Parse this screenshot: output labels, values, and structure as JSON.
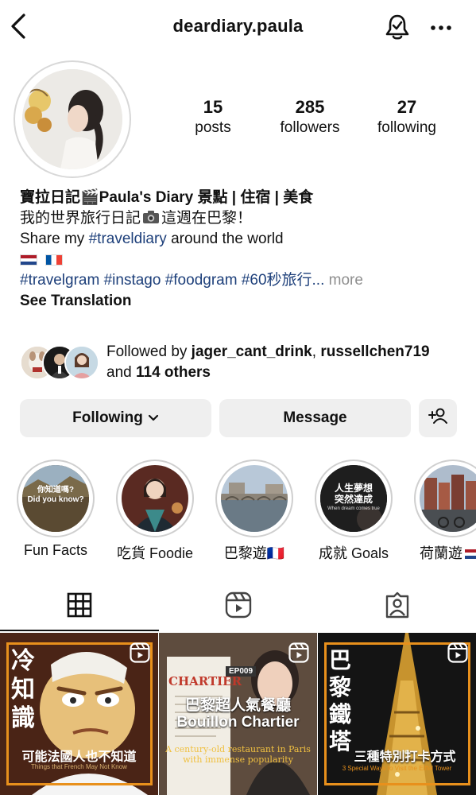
{
  "header": {
    "username": "deardiary.paula"
  },
  "stats": [
    {
      "num": "15",
      "label": "posts"
    },
    {
      "num": "285",
      "label": "followers"
    },
    {
      "num": "27",
      "label": "following"
    }
  ],
  "bio": {
    "name": "寶拉日記🎬Paula's Diary 景點 | 住宿 | 美食",
    "line1_a": "我的世界旅行日記",
    "line1_b": "這週在巴黎！",
    "line2_a": "Share my ",
    "line2_tag": "#traveldiary",
    "line2_b": " around the world",
    "hashtags": "#travelgram #instago #foodgram #60秒旅行...",
    "more": "more",
    "see_translation": "See Translation"
  },
  "followed_by": {
    "prefix": "Followed by ",
    "user1": "jager_cant_drink",
    "sep": ", ",
    "user2": "russellchen719",
    "and": "and ",
    "others": "114 others"
  },
  "actions": {
    "following": "Following",
    "message": "Message"
  },
  "highlights": [
    {
      "label": "Fun Facts",
      "text": "你知道嗎?\nDid you know?"
    },
    {
      "label": "吃貨 Foodie"
    },
    {
      "label": "巴黎遊🇫🇷"
    },
    {
      "label": "成就 Goals",
      "text": "人生夢想\n突然達成",
      "sub": "When dream comes true"
    },
    {
      "label": "荷蘭遊"
    }
  ],
  "grid": [
    {
      "title": "冷\n知\n識",
      "caption": "可能法國人也不知道",
      "sub": "Things that French May Not Know",
      "accent": "#e8901c"
    },
    {
      "badge": "EP009",
      "sign": "CHARTIER",
      "title": "巴黎超人氣餐廳",
      "subtitle": "Bouillon Chartier",
      "caption": "A century-old restaurant in Paris\nwith immense popularity"
    },
    {
      "title": "巴\n黎\n鐵\n塔",
      "caption": "三種特別打卡方式",
      "sub": "3 Special Ways to Visit the Eiffel Tower",
      "accent": "#e8901c"
    }
  ],
  "colors": {
    "hashtag": "#1d3f7a",
    "button_bg": "#efefef",
    "muted": "#8e8e8e"
  }
}
